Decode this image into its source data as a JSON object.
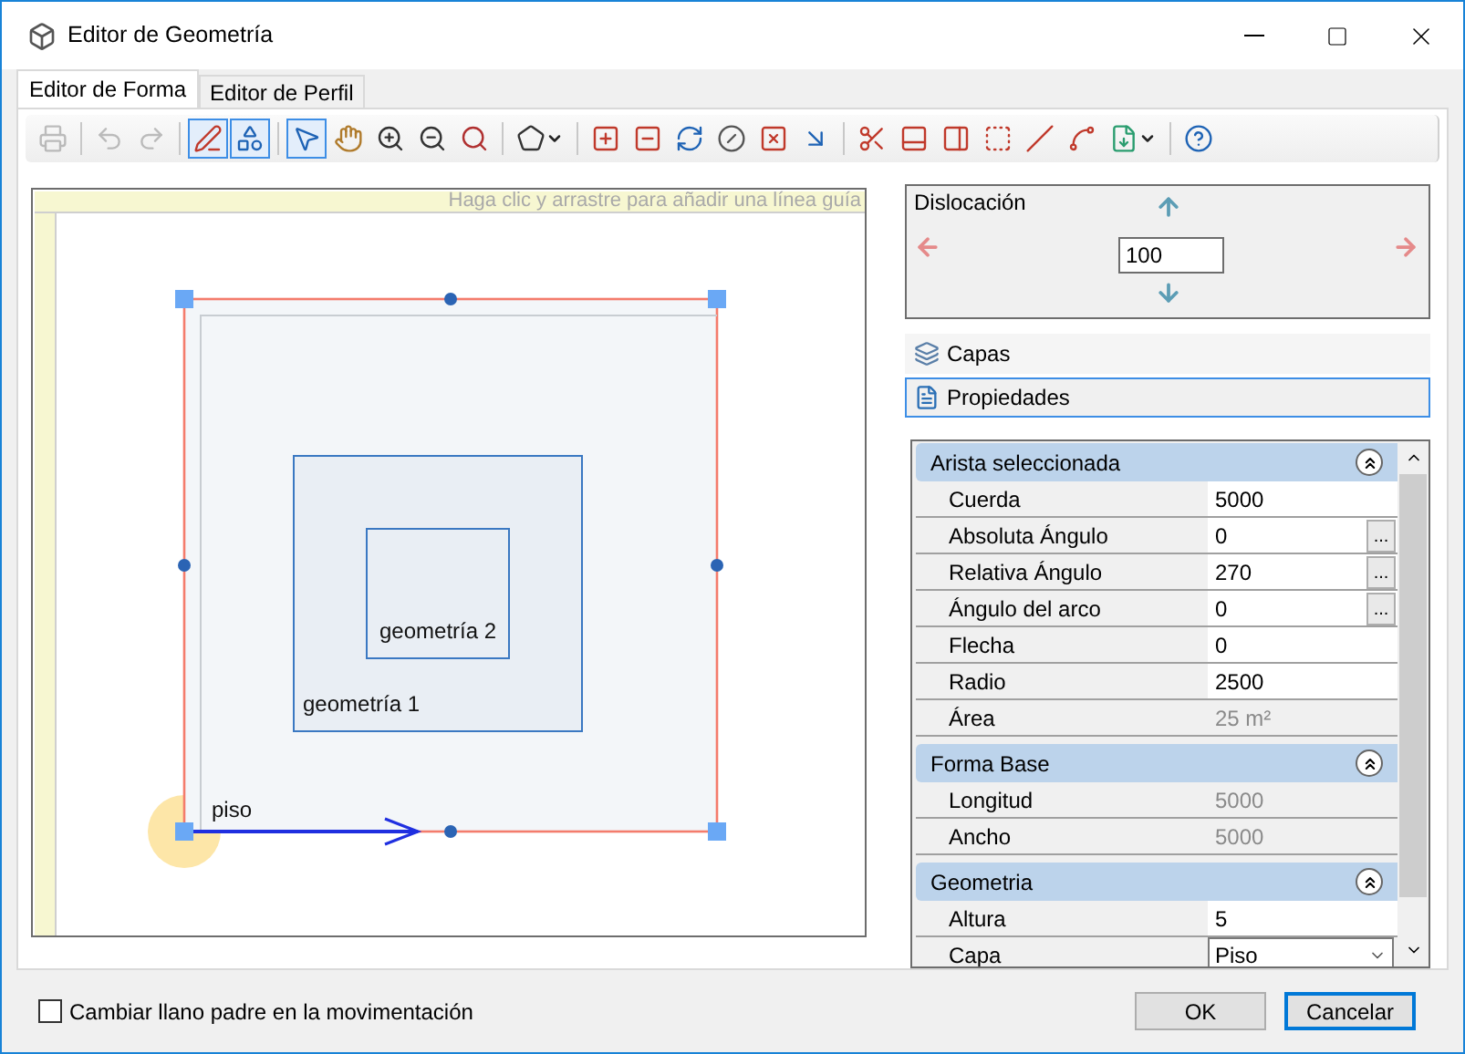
{
  "window": {
    "title": "Editor de Geometría"
  },
  "tabs": [
    {
      "label": "Editor de Forma",
      "selected": true
    },
    {
      "label": "Editor de Perfil",
      "selected": false
    }
  ],
  "toolbar": [
    {
      "kind": "button",
      "selected": false,
      "disabled": true
    },
    {
      "kind": "separator"
    },
    {
      "kind": "button",
      "selected": false,
      "disabled": true
    },
    {
      "kind": "button",
      "selected": false,
      "disabled": true
    },
    {
      "kind": "separator"
    },
    {
      "kind": "button",
      "selected": true,
      "disabled": false
    },
    {
      "kind": "button",
      "selected": true,
      "disabled": false
    },
    {
      "kind": "separator"
    },
    {
      "kind": "button",
      "selected": true,
      "disabled": false
    },
    {
      "kind": "button",
      "selected": false,
      "disabled": false
    },
    {
      "kind": "button",
      "selected": false,
      "disabled": false
    },
    {
      "kind": "button",
      "selected": false,
      "disabled": false
    },
    {
      "kind": "button",
      "selected": false,
      "disabled": false
    },
    {
      "kind": "separator"
    },
    {
      "kind": "dropdown",
      "selected": false,
      "disabled": false
    },
    {
      "kind": "separator"
    },
    {
      "kind": "button",
      "selected": false,
      "disabled": false
    },
    {
      "kind": "button",
      "selected": false,
      "disabled": false
    },
    {
      "kind": "button",
      "selected": false,
      "disabled": false
    },
    {
      "kind": "button",
      "selected": false,
      "disabled": false
    },
    {
      "kind": "button",
      "selected": false,
      "disabled": false
    },
    {
      "kind": "button",
      "selected": false,
      "disabled": false
    },
    {
      "kind": "separator"
    },
    {
      "kind": "button",
      "selected": false,
      "disabled": false
    },
    {
      "kind": "button",
      "selected": false,
      "disabled": false
    },
    {
      "kind": "button",
      "selected": false,
      "disabled": false
    },
    {
      "kind": "button",
      "selected": false,
      "disabled": false
    },
    {
      "kind": "button",
      "selected": false,
      "disabled": false
    },
    {
      "kind": "button",
      "selected": false,
      "disabled": false
    },
    {
      "kind": "dropdown",
      "selected": false,
      "disabled": false
    },
    {
      "kind": "separator"
    },
    {
      "kind": "button",
      "selected": false,
      "disabled": false
    }
  ],
  "canvas": {
    "hint": "Haga clic y arrastre para añadir una línea guía",
    "shapes": [
      {
        "label": "piso"
      },
      {
        "label": "geometría 1"
      },
      {
        "label": "geometría 2"
      }
    ]
  },
  "displacement": {
    "title": "Dislocación",
    "value": "100"
  },
  "panels": [
    {
      "label": "Capas",
      "selected": false
    },
    {
      "label": "Propiedades",
      "selected": true
    }
  ],
  "property_groups": [
    {
      "title": "Arista seleccionada",
      "expanded": true,
      "rows": [
        {
          "name": "Cuerda",
          "value": "5000",
          "kind": "text"
        },
        {
          "name": "Absoluta Ángulo",
          "value": "0",
          "kind": "button",
          "button_label": "..."
        },
        {
          "name": "Relativa Ángulo",
          "value": "270",
          "kind": "button",
          "button_label": "..."
        },
        {
          "name": "Ángulo del arco",
          "value": "0",
          "kind": "button",
          "button_label": "..."
        },
        {
          "name": "Flecha",
          "value": "0",
          "kind": "text"
        },
        {
          "name": "Radio",
          "value": "2500",
          "kind": "text"
        },
        {
          "name": "Área",
          "value": "25 m²",
          "kind": "readonly"
        }
      ]
    },
    {
      "title": "Forma Base",
      "expanded": true,
      "rows": [
        {
          "name": "Longitud",
          "value": "5000",
          "kind": "readonly"
        },
        {
          "name": "Ancho",
          "value": "5000",
          "kind": "readonly"
        }
      ]
    },
    {
      "title": "Geometria",
      "expanded": true,
      "rows": [
        {
          "name": "Altura",
          "value": "5",
          "kind": "text"
        },
        {
          "name": "Capa",
          "value": "Piso",
          "kind": "select"
        }
      ]
    }
  ],
  "footer": {
    "checkbox": {
      "label": "Cambiar llano padre en la movimentación",
      "checked": false
    },
    "buttons": [
      {
        "label": "OK",
        "default": false
      },
      {
        "label": "Cancelar",
        "default": true
      }
    ]
  }
}
